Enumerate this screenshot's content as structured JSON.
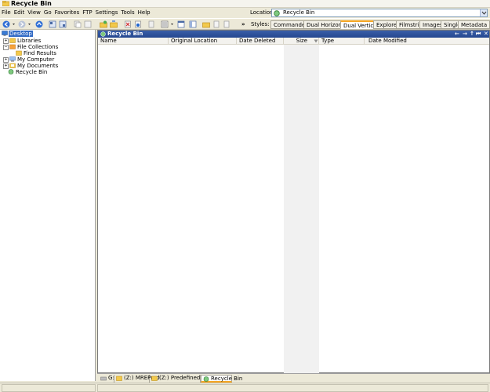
{
  "window": {
    "title": "Recycle Bin"
  },
  "menu": [
    "File",
    "Edit",
    "View",
    "Go",
    "Favorites",
    "FTP",
    "Settings",
    "Tools",
    "Help"
  ],
  "location": {
    "label": "Location",
    "value": "Recycle Bin"
  },
  "toolbar": {
    "chevron": "»",
    "styles_label": "Styles:"
  },
  "styles_tabs": [
    "Commander",
    "Dual Horizontal",
    "Dual Vertical",
    "Explorer",
    "Filmstrip",
    "Images",
    "Single",
    "Metadata"
  ],
  "active_style": "Dual Vertical",
  "tree": {
    "items": [
      {
        "label": "Desktop",
        "selected": true
      },
      {
        "label": "Libraries",
        "expander": "+"
      },
      {
        "label": "File Collections",
        "expander": "−"
      },
      {
        "label": "Find Results"
      },
      {
        "label": "My Computer",
        "expander": "+"
      },
      {
        "label": "My Documents",
        "expander": "+"
      },
      {
        "label": "Recycle Bin"
      }
    ]
  },
  "panel": {
    "title": "Recycle Bin",
    "nav": [
      "←",
      "→",
      "↑",
      "⏮",
      "✕"
    ],
    "columns": [
      "Name",
      "Original Location",
      "Date Deleted",
      "Size",
      "Type",
      "Date Modified"
    ]
  },
  "bottom_tabs": [
    {
      "label": "G:"
    },
    {
      "label": "(Z:) MREProd"
    },
    {
      "label": "(Z:) PredefinedReports"
    },
    {
      "label": "Recycle Bin",
      "active": true
    }
  ],
  "colors": {
    "accent": "#f5a623",
    "header_blue": "#24468f",
    "selection": "#316ac5"
  }
}
